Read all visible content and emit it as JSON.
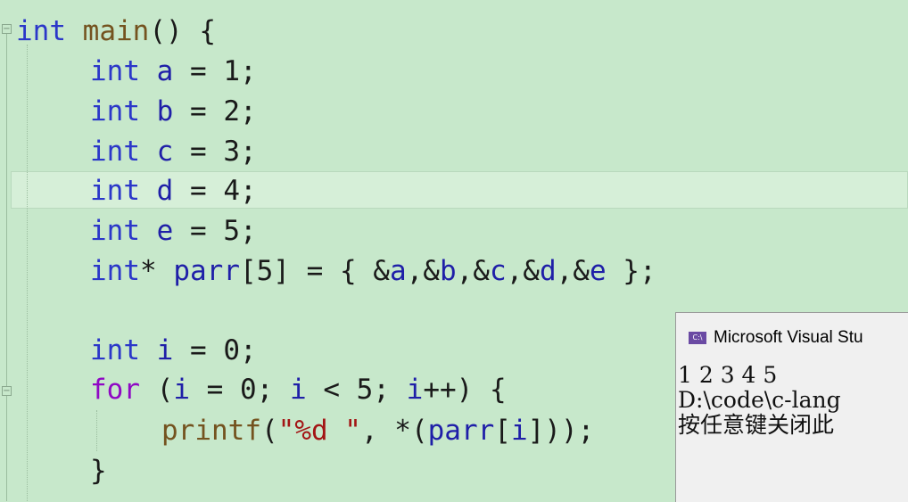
{
  "editor": {
    "lines": [
      {
        "kw": "int",
        "rest": " main() {"
      },
      {
        "kw": "int",
        "rest": " a = 1;"
      },
      {
        "kw": "int",
        "rest": " b = 2;"
      },
      {
        "kw": "int",
        "rest": " c = 3;"
      },
      {
        "kw": "int",
        "rest": " d = 4;"
      },
      {
        "kw": "int",
        "rest": " e = 5;"
      },
      {
        "kw": "int",
        "rest": "* parr[5] = { &a,&b,&c,&d,&e };"
      },
      {
        "kw": "",
        "rest": ""
      },
      {
        "kw": "int",
        "rest": " i = 0;"
      },
      {
        "kw": "for",
        "rest": " (i = 0; i < 5; i++) {"
      },
      {
        "kw": "",
        "rest": "printf(\"%d \", *(parr[i]));"
      },
      {
        "kw": "",
        "rest": "}"
      }
    ]
  },
  "console": {
    "title": "Microsoft Visual Stu",
    "icon": "console-app-icon",
    "icon_text": "C:\\",
    "output": [
      "1 2 3 4 5",
      "D:\\code\\c-lang",
      "按任意键关闭此"
    ]
  }
}
